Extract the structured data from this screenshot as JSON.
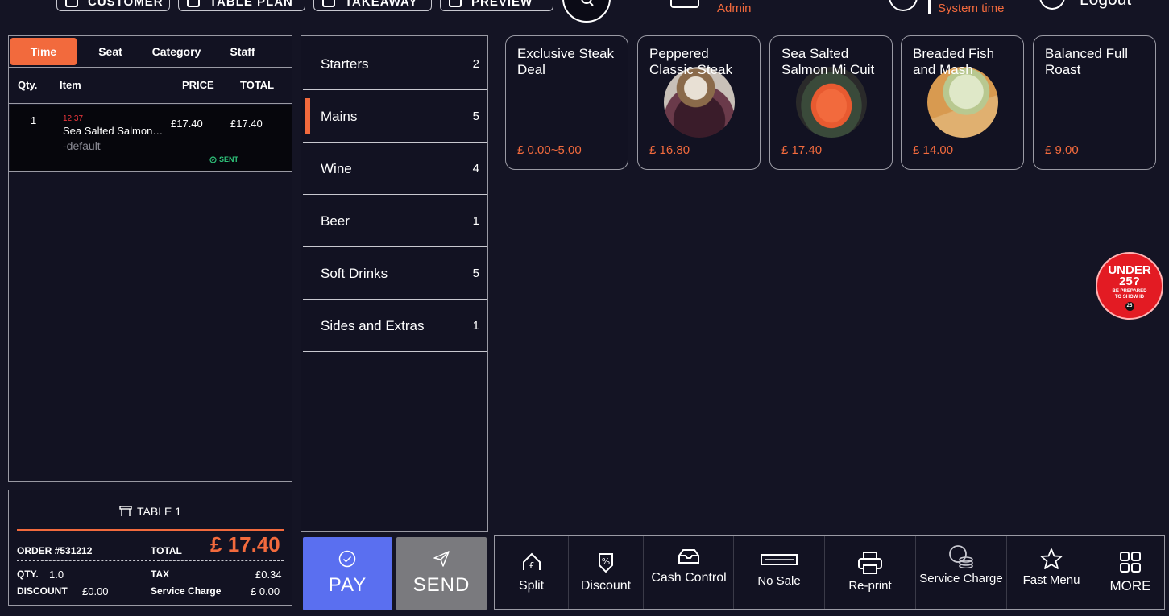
{
  "topbar": {
    "customer": "CUSTOMER",
    "table_plan": "TABLE PLAN",
    "takeaway": "TAKEAWAY",
    "preview": "PREVIEW",
    "admin": "Admin",
    "system_time": "System time",
    "logout": "Logout"
  },
  "order": {
    "sort_tabs": [
      "Time",
      "Seat",
      "Category",
      "Staff"
    ],
    "headers": {
      "qty": "Qty.",
      "item": "Item",
      "price": "PRICE",
      "total": "TOTAL"
    },
    "items": [
      {
        "qty": "1",
        "time": "12:37",
        "name": "Sea Salted Salmon…",
        "modifier": "-default",
        "price": "£17.40",
        "total": "£17.40",
        "status": "SENT"
      }
    ]
  },
  "summary": {
    "table": "TABLE 1",
    "order_no": "ORDER #531212",
    "total_label": "TOTAL",
    "total_currency": "£",
    "total_value": "17.40",
    "qty_label": "QTY.",
    "qty_value": "1.0",
    "tax_label": "TAX",
    "tax_value": "£0.34",
    "discount_label": "DISCOUNT",
    "discount_value": "£0.00",
    "service_label": "Service Charge",
    "service_value": "£ 0.00"
  },
  "categories": [
    {
      "label": "Starters",
      "count": "2"
    },
    {
      "label": "Mains",
      "count": "5",
      "active": true
    },
    {
      "label": "Wine",
      "count": "4"
    },
    {
      "label": "Beer",
      "count": "1"
    },
    {
      "label": "Soft Drinks",
      "count": "5"
    },
    {
      "label": "Sides and Extras",
      "count": "1"
    }
  ],
  "products": [
    {
      "name": "Exclusive Steak Deal",
      "price": "£ 0.00~5.00",
      "image": "none"
    },
    {
      "name": "Peppered Classic Steak",
      "price": "£ 16.80",
      "image": "steak-photo"
    },
    {
      "name": "Sea Salted Salmon Mi Cuit",
      "price": "£ 17.40",
      "image": "salmon-photo"
    },
    {
      "name": "Breaded Fish and Mash",
      "price": "£ 14.00",
      "image": "fish-photo"
    },
    {
      "name": "Balanced Full Roast",
      "price": "£ 9.00",
      "image": "none"
    }
  ],
  "badge": {
    "line1": "UNDER",
    "line2": "25?",
    "line3": "BE PREPARED",
    "line4": "TO SHOW ID",
    "line5": "25"
  },
  "actions": {
    "pay": "PAY",
    "send": "SEND"
  },
  "toolbar": [
    {
      "label": "Split",
      "icon": "split-icon"
    },
    {
      "label": "Discount",
      "icon": "discount-icon"
    },
    {
      "label": "Cash Control",
      "icon": "cash-drawer-icon"
    },
    {
      "label": "No Sale",
      "icon": "till-icon"
    },
    {
      "label": "Re-print",
      "icon": "printer-icon"
    },
    {
      "label": "Service Charge",
      "icon": "coins-icon"
    },
    {
      "label": "Fast Menu",
      "icon": "star-icon"
    },
    {
      "label": "MORE",
      "icon": "grid-icon"
    }
  ],
  "colors": {
    "accent": "#f26a3d",
    "pay": "#5a6ff0",
    "send": "#7a7a7e",
    "sent": "#2ec27a",
    "background": "#141424"
  }
}
